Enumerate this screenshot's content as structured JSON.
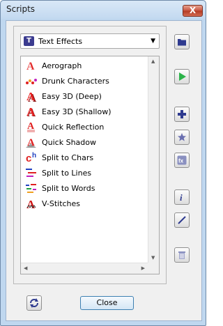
{
  "window": {
    "title": "Scripts",
    "close_glyph": "X"
  },
  "category": {
    "icon_letter": "T",
    "selected": "Text Effects",
    "caret": "▼"
  },
  "scripts": [
    {
      "label": "Aerograph",
      "icon": "aerograph-icon"
    },
    {
      "label": "Drunk Characters",
      "icon": "drunk-characters-icon"
    },
    {
      "label": "Easy 3D (Deep)",
      "icon": "easy-3d-deep-icon"
    },
    {
      "label": "Easy 3D (Shallow)",
      "icon": "easy-3d-shallow-icon"
    },
    {
      "label": "Quick Reflection",
      "icon": "quick-reflection-icon"
    },
    {
      "label": "Quick Shadow",
      "icon": "quick-shadow-icon"
    },
    {
      "label": "Split to Chars",
      "icon": "split-to-chars-icon"
    },
    {
      "label": "Split to Lines",
      "icon": "split-to-lines-icon"
    },
    {
      "label": "Split to Words",
      "icon": "split-to-words-icon"
    },
    {
      "label": "V-Stitches",
      "icon": "v-stitches-icon"
    }
  ],
  "scroll": {
    "up": "▲",
    "down": "▼",
    "left": "◀",
    "right": "▶"
  },
  "buttons": {
    "close": "Close"
  },
  "colors": {
    "accent": "#3c7fb1",
    "play": "#2cb34a",
    "icon_blue": "#2e3a8f",
    "red": "#d01818"
  }
}
